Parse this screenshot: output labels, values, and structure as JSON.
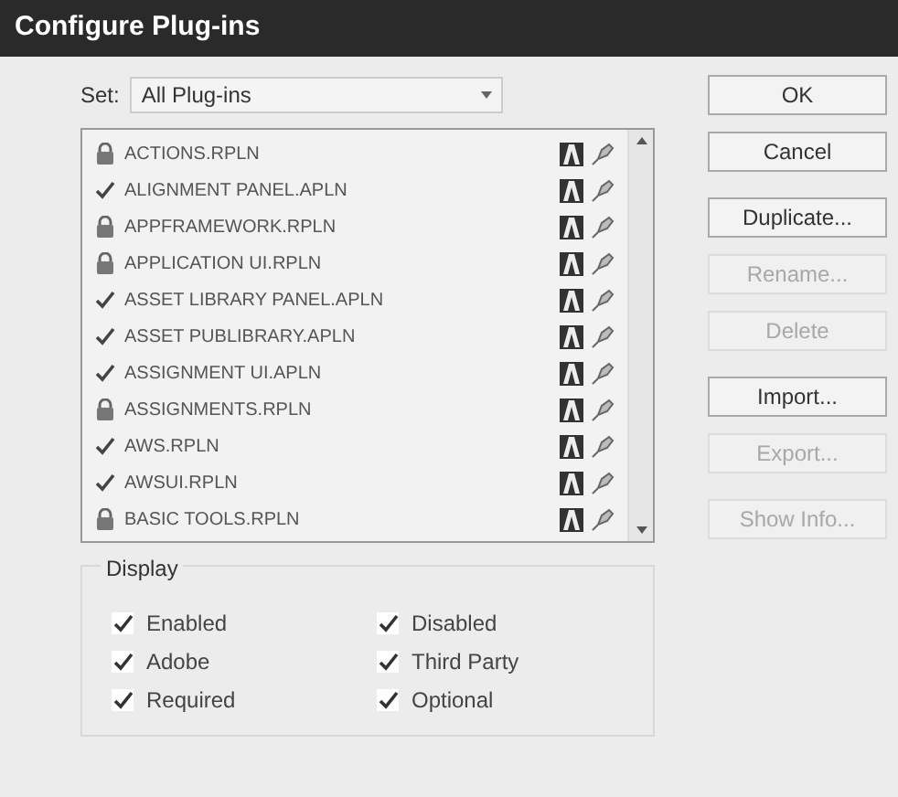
{
  "window": {
    "title": "Configure Plug-ins"
  },
  "set": {
    "label": "Set:",
    "value": "All Plug-ins"
  },
  "plugins": [
    {
      "name": "ACTIONS.RPLN",
      "kind": "required"
    },
    {
      "name": "ALIGNMENT PANEL.APLN",
      "kind": "enabled"
    },
    {
      "name": "APPFRAMEWORK.RPLN",
      "kind": "required"
    },
    {
      "name": "APPLICATION UI.RPLN",
      "kind": "required"
    },
    {
      "name": "ASSET LIBRARY PANEL.APLN",
      "kind": "enabled"
    },
    {
      "name": "ASSET PUBLIBRARY.APLN",
      "kind": "enabled"
    },
    {
      "name": "ASSIGNMENT UI.APLN",
      "kind": "enabled"
    },
    {
      "name": "ASSIGNMENTS.RPLN",
      "kind": "required"
    },
    {
      "name": "AWS.RPLN",
      "kind": "enabled"
    },
    {
      "name": "AWSUI.RPLN",
      "kind": "enabled"
    },
    {
      "name": "BASIC TOOLS.RPLN",
      "kind": "required"
    }
  ],
  "display": {
    "title": "Display",
    "options": [
      {
        "label": "Enabled",
        "checked": true
      },
      {
        "label": "Disabled",
        "checked": true
      },
      {
        "label": "Adobe",
        "checked": true
      },
      {
        "label": "Third Party",
        "checked": true
      },
      {
        "label": "Required",
        "checked": true
      },
      {
        "label": "Optional",
        "checked": true
      }
    ]
  },
  "buttons": [
    {
      "label": "OK",
      "disabled": false
    },
    {
      "label": "Cancel",
      "disabled": false
    },
    {
      "label": "Duplicate...",
      "disabled": false
    },
    {
      "label": "Rename...",
      "disabled": true
    },
    {
      "label": "Delete",
      "disabled": true
    },
    {
      "label": "Import...",
      "disabled": false
    },
    {
      "label": "Export...",
      "disabled": true
    },
    {
      "label": "Show Info...",
      "disabled": true
    }
  ]
}
